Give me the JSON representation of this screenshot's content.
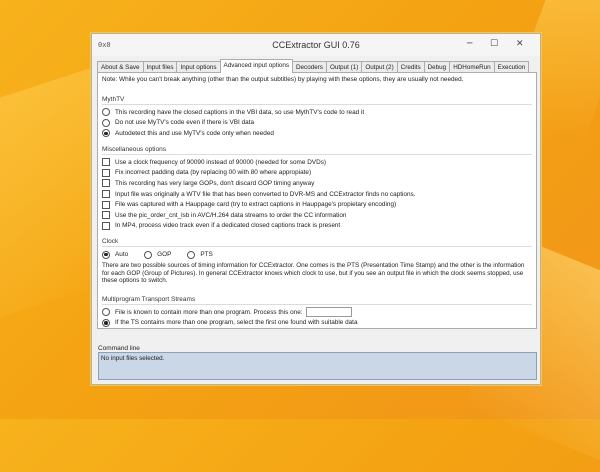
{
  "window": {
    "title": "CCExtractor GUI 0.76",
    "app_icon": "0x0",
    "minimize": "─",
    "maximize": "☐",
    "close": "✕"
  },
  "tabs": [
    {
      "label": "About & Save",
      "active": false
    },
    {
      "label": "Input files",
      "active": false
    },
    {
      "label": "Input options",
      "active": false
    },
    {
      "label": "Advanced input options",
      "active": true
    },
    {
      "label": "Decoders",
      "active": false
    },
    {
      "label": "Output (1)",
      "active": false
    },
    {
      "label": "Output (2)",
      "active": false
    },
    {
      "label": "Credits",
      "active": false
    },
    {
      "label": "Debug",
      "active": false
    },
    {
      "label": "HDHomeRun",
      "active": false
    },
    {
      "label": "Execution",
      "active": false
    }
  ],
  "note": "Note: While you can't break anything (other than the output subtitles) by playing with these options, they are usually not needed.",
  "mythtv": {
    "title": "MythTV",
    "options": [
      {
        "label": "This recording have the closed captions in the VBI data, so use MythTV's code to read it",
        "selected": false
      },
      {
        "label": "Do not use MyTV's code even if there is VBI data",
        "selected": false
      },
      {
        "label": "Autodetect this and use MyTV's code only when needed",
        "selected": true
      }
    ]
  },
  "misc": {
    "title": "Miscellaneous options",
    "options": [
      {
        "label": "Use a clock frequency of 90090 instead of 90000 (needed for some DVDs)",
        "checked": false
      },
      {
        "label": "Fix incorrect padding data (by replacing 00 with 80 where appropiate)",
        "checked": false
      },
      {
        "label": "This recording has very large GOPs, don't discard GOP timing anyway",
        "checked": false
      },
      {
        "label": "Input file was originally a WTV file that has been converted to DVR-MS and CCExtractor finds no captions.",
        "checked": false
      },
      {
        "label": "File was captured with a Hauppage card (try to extract captions in Hauppage's propietary encoding)",
        "checked": false
      },
      {
        "label": "Use the pic_order_cnt_lsb in AVC/H.264 data streams to order the CC information",
        "checked": false
      },
      {
        "label": "In MP4, process video track even if a dedicated closed captions track is present",
        "checked": false
      }
    ]
  },
  "clock": {
    "title": "Clock",
    "options": [
      {
        "label": "Auto",
        "selected": true
      },
      {
        "label": "GOP",
        "selected": false
      },
      {
        "label": "PTS",
        "selected": false
      }
    ],
    "description": "There are two possible sources of timing information for CCExtractor. One comes is the PTS (Presentation Time Stamp) and the other is the information for each GOP (Group of Pictures). In general CCExtractor knows which clock to use, but if you see an output file in which the clock seems stopped, use these options to switch."
  },
  "multiprogram": {
    "title": "Multiprogram Transport Streams",
    "options": [
      {
        "label": "File is known to contain more than one program. Process this one:",
        "selected": false
      },
      {
        "label": "If the TS contains more than one program, select the first one found with suitable data",
        "selected": true
      }
    ],
    "program_value": ""
  },
  "command_line": {
    "label": "Command line",
    "text": "No input files selected."
  }
}
